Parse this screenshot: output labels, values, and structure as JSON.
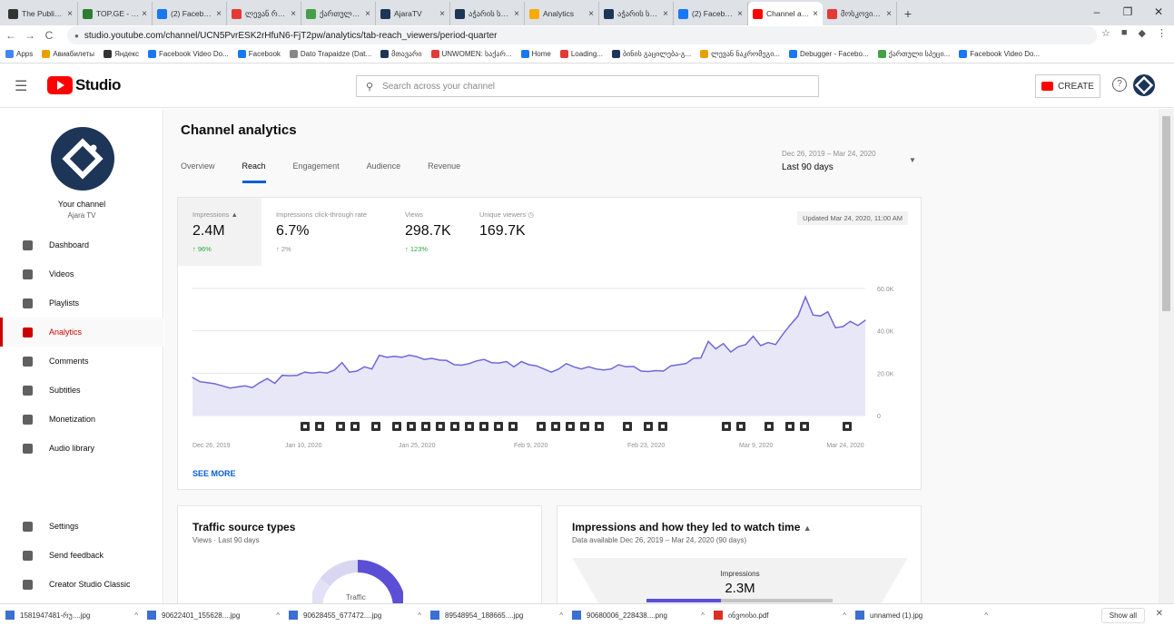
{
  "browser": {
    "tabs": [
      {
        "title": "The Public Bro",
        "color": "#333333"
      },
      {
        "title": "TOP.GE - RATI",
        "color": "#2e7d32"
      },
      {
        "title": "(2) Facebook",
        "color": "#1877f2"
      },
      {
        "title": "ლევან რაგი",
        "color": "#e53935"
      },
      {
        "title": "ქართული სა",
        "color": "#43a047"
      },
      {
        "title": "AjaraTV",
        "color": "#1d3557"
      },
      {
        "title": "აჭარის საზო",
        "color": "#1d3557"
      },
      {
        "title": "Analytics",
        "color": "#f9ab00"
      },
      {
        "title": "აჭარის საზო",
        "color": "#1d3557"
      },
      {
        "title": "(2) Facebook",
        "color": "#1877f2"
      },
      {
        "title": "Channel analy",
        "color": "#ff0000",
        "active": true
      },
      {
        "title": "მოსკოვის მე",
        "color": "#e53935"
      }
    ],
    "new_tab": "+",
    "window_controls": [
      "–",
      "❐",
      "✕"
    ],
    "url": "studio.youtube.com/channel/UCN5PvrESK2rHfuN6-FjT2pw/analytics/tab-reach_viewers/period-quarter",
    "bookmarks": [
      "Apps",
      "Авиабилеты",
      "Яндекс",
      "Facebook Video Do...",
      "Facebook",
      "Dato Trapaidze (Dat...",
      "მთავარი",
      "UNWOMEN: საქარ...",
      "Home",
      "Loading...",
      "ბინის გაცილება-გ...",
      "ლევან ნაკრომეგი...",
      "Debugger - Facebo...",
      "ქართული სპეცი...",
      "Facebook Video Do..."
    ]
  },
  "header": {
    "logo_text": "Studio",
    "search_placeholder": "Search across your channel",
    "create_label": "CREATE",
    "help": "?"
  },
  "sidebar": {
    "channel_title": "Your channel",
    "channel_name": "Ajara TV",
    "items": [
      {
        "label": "Dashboard",
        "icon": "dashboard-icon"
      },
      {
        "label": "Videos",
        "icon": "videos-icon"
      },
      {
        "label": "Playlists",
        "icon": "playlists-icon"
      },
      {
        "label": "Analytics",
        "icon": "analytics-icon",
        "active": true
      },
      {
        "label": "Comments",
        "icon": "comments-icon"
      },
      {
        "label": "Subtitles",
        "icon": "subtitles-icon"
      },
      {
        "label": "Monetization",
        "icon": "monetization-icon"
      },
      {
        "label": "Audio library",
        "icon": "audio-library-icon"
      }
    ],
    "bottom_items": [
      {
        "label": "Settings",
        "icon": "gear-icon"
      },
      {
        "label": "Send feedback",
        "icon": "feedback-icon"
      },
      {
        "label": "Creator Studio Classic",
        "icon": "classic-icon"
      }
    ]
  },
  "main": {
    "title": "Channel analytics",
    "tabs": [
      "Overview",
      "Reach",
      "Engagement",
      "Audience",
      "Revenue"
    ],
    "active_tab": "Reach",
    "date_range": "Dec 26, 2019 – Mar 24, 2020",
    "date_label": "Last 90 days",
    "metrics": [
      {
        "label": "Impressions",
        "value": "2.4M",
        "change": "↑ 96%",
        "change_color": "#2ba640",
        "selected": true
      },
      {
        "label": "Impressions click-through rate",
        "value": "6.7%",
        "change": "↑ 2%",
        "change_color": "#909090"
      },
      {
        "label": "Views",
        "value": "298.7K",
        "change": "↑ 123%",
        "change_color": "#2ba640"
      },
      {
        "label": "Unique viewers",
        "value": "169.7K",
        "change": "",
        "change_color": "#909090"
      }
    ],
    "updated": "Updated Mar 24, 2020, 11:00 AM",
    "see_more": "SEE MORE",
    "traffic_title": "Traffic source types",
    "traffic_sub": "Views · Last 90 days",
    "traffic_center": "Traffic",
    "imp_title": "Impressions and how they led to watch time",
    "imp_sub": "Data available Dec 26, 2019 – Mar 24, 2020 (90 days)",
    "imp_label": "Impressions",
    "imp_value": "2.3M"
  },
  "chart_data": {
    "type": "area",
    "series_color": "#6f68d8",
    "fill_color": "#e8e7f8",
    "ylim": [
      0,
      60000
    ],
    "y_ticks": [
      "0",
      "20.0K",
      "40.0K",
      "60.0K"
    ],
    "x_ticks": [
      "Dec 26, 2019",
      "Jan 10, 2020",
      "Jan 25, 2020",
      "Feb 9, 2020",
      "Feb 23, 2020",
      "Mar 9, 2020",
      "Mar 24, 2020"
    ],
    "values": [
      18000,
      16000,
      15500,
      15000,
      14000,
      13000,
      13500,
      14000,
      13200,
      15500,
      17500,
      15200,
      19000,
      18800,
      19000,
      20500,
      20000,
      20500,
      20100,
      21500,
      25000,
      20500,
      21000,
      23000,
      22000,
      28500,
      27500,
      28000,
      27500,
      28500,
      27800,
      26500,
      27000,
      26200,
      26000,
      24000,
      23800,
      24500,
      25800,
      26500,
      25000,
      24800,
      25500,
      23000,
      25500,
      24000,
      23500,
      22000,
      20500,
      22000,
      24500,
      23000,
      22000,
      23000,
      22000,
      21500,
      22000,
      24000,
      23000,
      23200,
      21000,
      20800,
      21200,
      21000,
      23500,
      24000,
      24500,
      27000,
      27200,
      35000,
      31500,
      34000,
      30000,
      32500,
      33500,
      37500,
      33000,
      34500,
      33500,
      38500,
      43000,
      47000,
      56000,
      47500,
      47000,
      49000,
      41500,
      42000,
      44500,
      42500,
      45000
    ],
    "markers": [
      "1",
      "1",
      "1",
      "1",
      "1",
      "1",
      "1",
      "1",
      "1",
      "1",
      "1",
      "1",
      "1",
      "1",
      "1",
      "1",
      "1",
      "1",
      "1",
      "1",
      "1",
      "1",
      "1",
      "1",
      "1",
      "1",
      "1",
      "1"
    ]
  },
  "downloads": [
    "1581947481-რუ....jpg",
    "90622401_155628....jpg",
    "90628455_677472....jpg",
    "89548954_188665....jpg",
    "90680006_228438....png",
    "ინვოისი.pdf",
    "unnamed (1).jpg"
  ],
  "show_all": "Show all"
}
